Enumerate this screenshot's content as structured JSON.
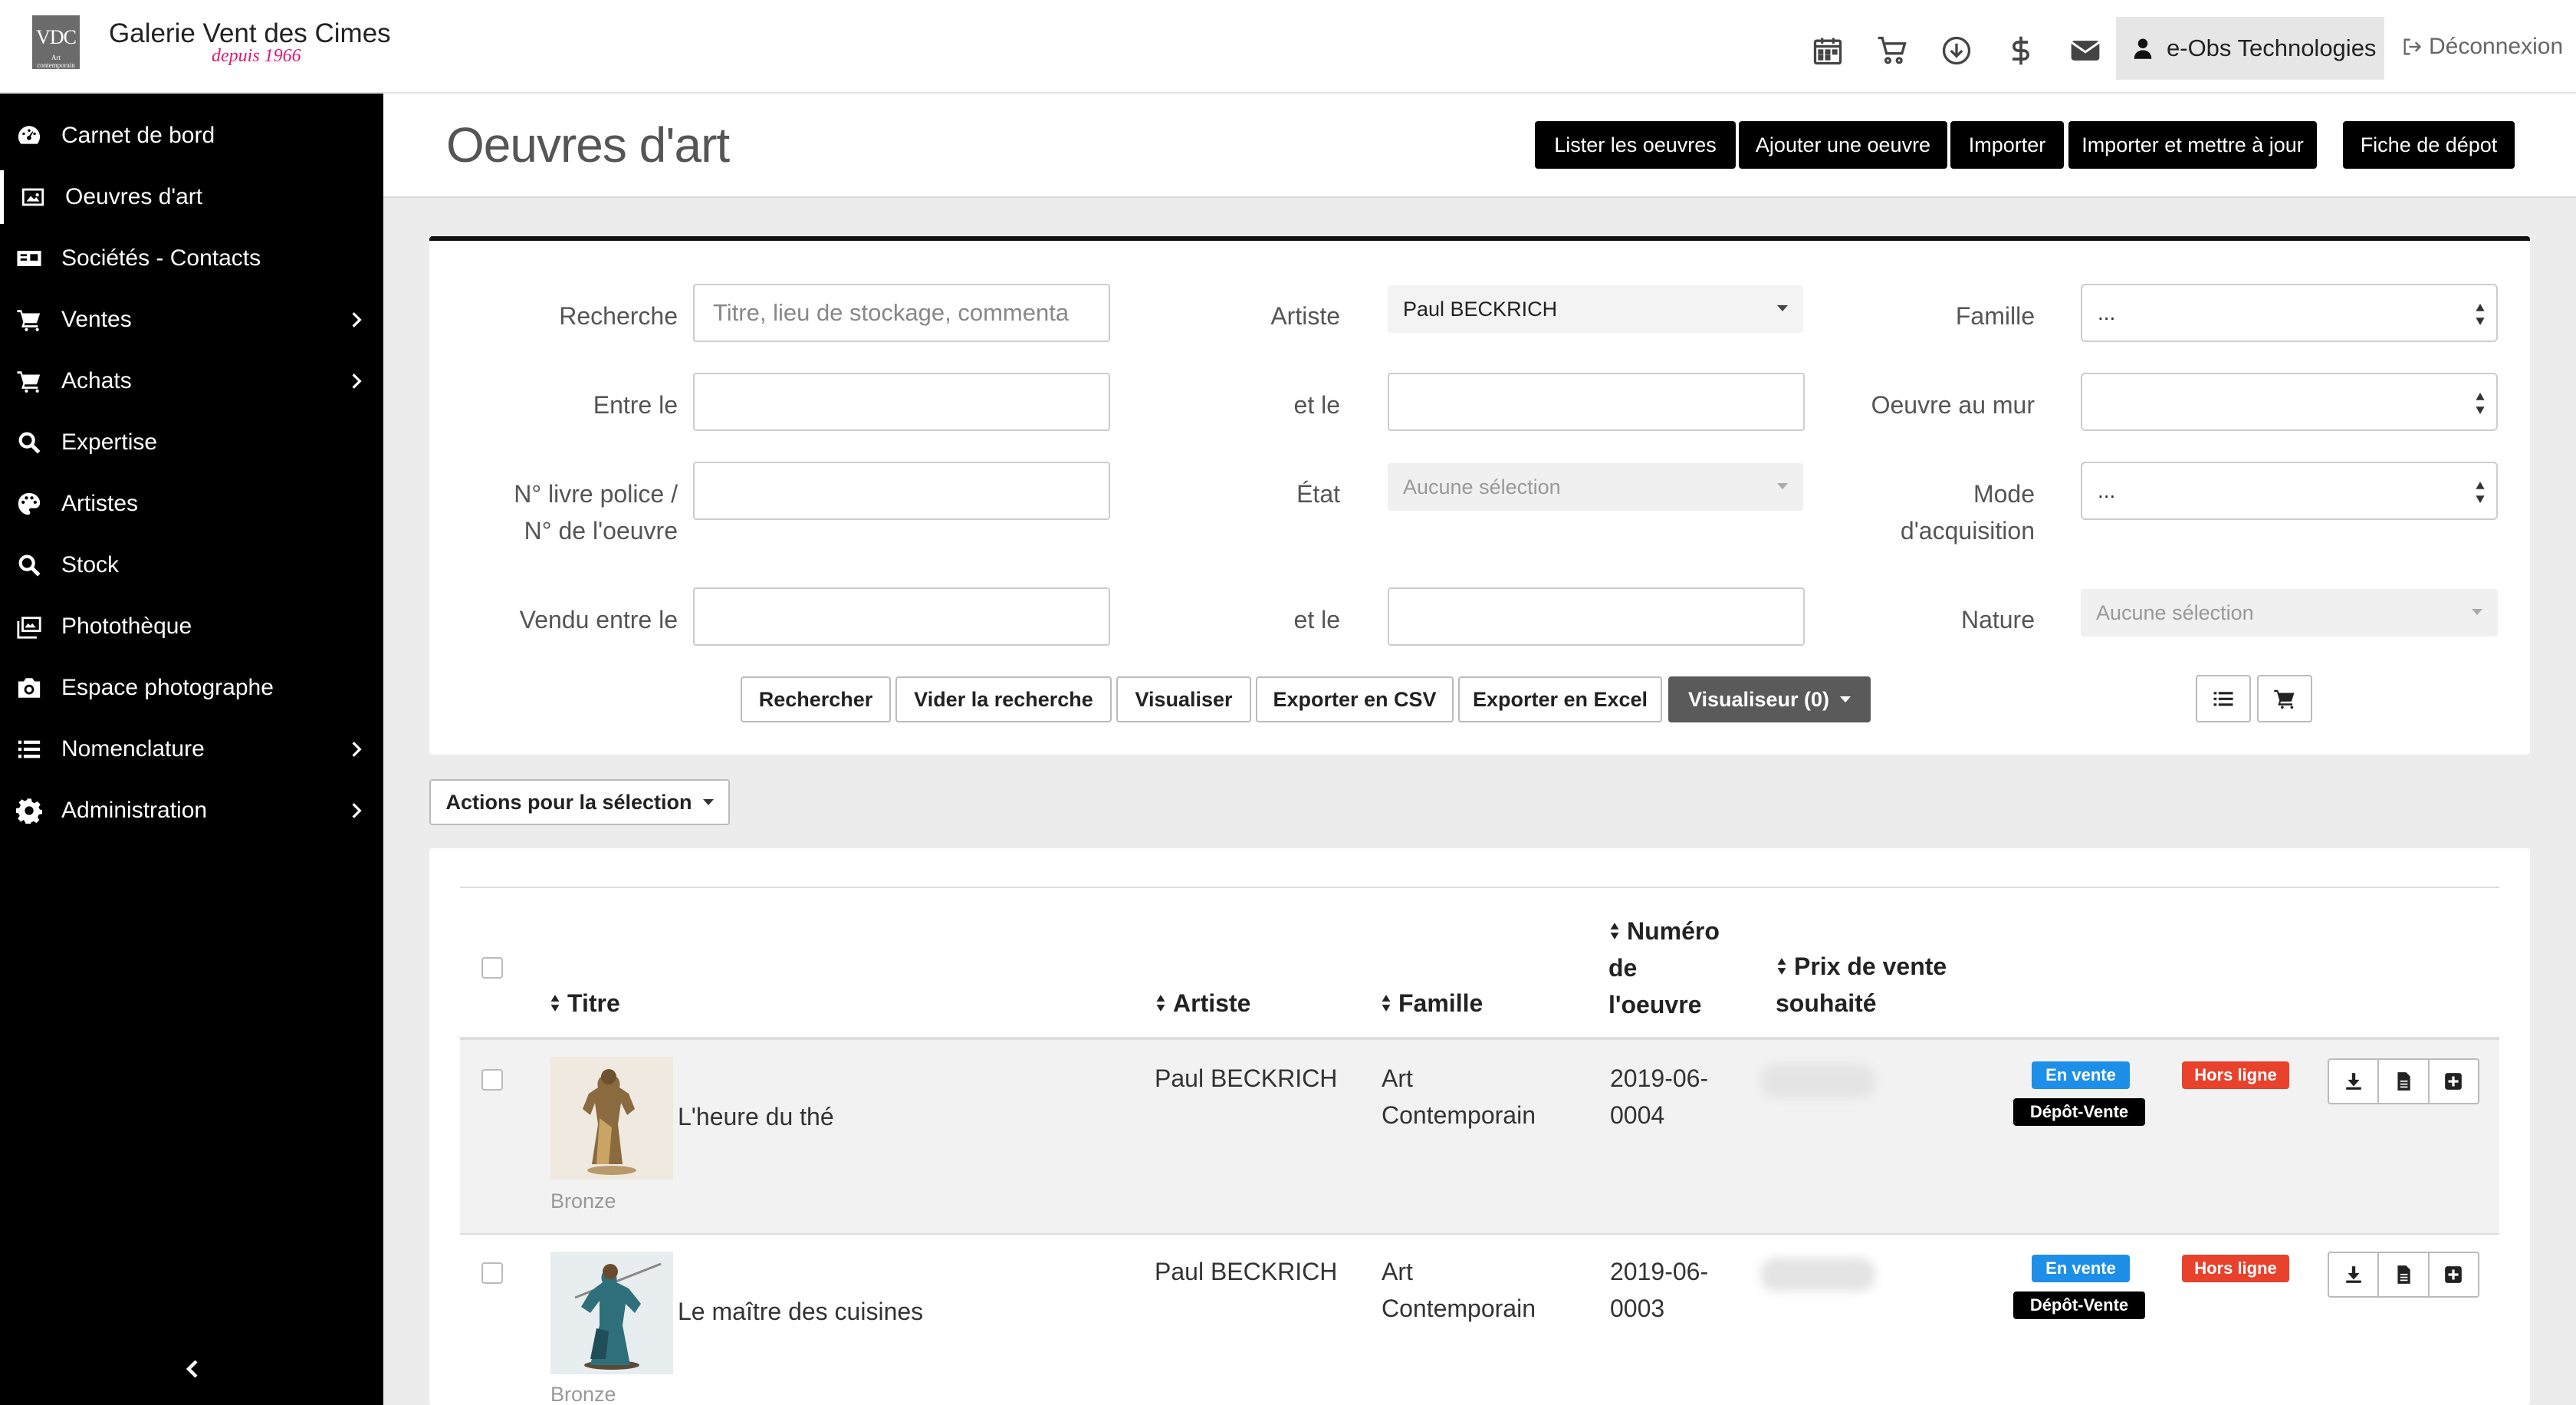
{
  "app": {
    "logo_text": "VDC",
    "logo_sub": "Art contemporain",
    "title": "Galerie Vent des Cimes",
    "tagline": "depuis 1966"
  },
  "topbar": {
    "icons": [
      "calendar-icon",
      "cart-icon",
      "download-icon",
      "dollar-icon",
      "mail-icon"
    ],
    "user_label": "e-Obs Technologies",
    "logout_label": "Déconnexion"
  },
  "sidebar": {
    "items": [
      {
        "label": "Carnet de bord",
        "icon": "dashboard-icon",
        "has_children": false,
        "active": false
      },
      {
        "label": "Oeuvres d'art",
        "icon": "image-icon",
        "has_children": false,
        "active": true
      },
      {
        "label": "Sociétés - Contacts",
        "icon": "contact-card-icon",
        "has_children": false,
        "active": false
      },
      {
        "label": "Ventes",
        "icon": "cart-icon",
        "has_children": true,
        "active": false
      },
      {
        "label": "Achats",
        "icon": "cart-icon",
        "has_children": true,
        "active": false
      },
      {
        "label": "Expertise",
        "icon": "search-icon",
        "has_children": false,
        "active": false
      },
      {
        "label": "Artistes",
        "icon": "palette-icon",
        "has_children": false,
        "active": false
      },
      {
        "label": "Stock",
        "icon": "search-icon",
        "has_children": false,
        "active": false
      },
      {
        "label": "Photothèque",
        "icon": "images-icon",
        "has_children": false,
        "active": false
      },
      {
        "label": "Espace photographe",
        "icon": "camera-icon",
        "has_children": false,
        "active": false
      },
      {
        "label": "Nomenclature",
        "icon": "list-icon",
        "has_children": true,
        "active": false
      },
      {
        "label": "Administration",
        "icon": "gear-icon",
        "has_children": true,
        "active": false
      }
    ]
  },
  "header": {
    "title": "Oeuvres d'art",
    "buttons": [
      "Lister les oeuvres",
      "Ajouter une oeuvre",
      "Importer",
      "Importer et mettre à jour",
      "Fiche de dépot"
    ]
  },
  "filters": {
    "recherche_label": "Recherche",
    "recherche_placeholder": "Titre, lieu de stockage, commenta",
    "artiste_label": "Artiste",
    "artiste_value": "Paul BECKRICH",
    "famille_label": "Famille",
    "famille_value": "...",
    "entre_label": "Entre le",
    "et_le_label": "et le",
    "mur_label": "Oeuvre au mur",
    "mur_value": "",
    "livre_label_1": "N° livre police /",
    "livre_label_2": "N° de l'oeuvre",
    "etat_label": "État",
    "etat_value": "Aucune sélection",
    "mode_label_1": "Mode",
    "mode_label_2": "d'acquisition",
    "mode_value": "...",
    "vendu_label": "Vendu entre le",
    "et_le_label_2": "et le",
    "nature_label": "Nature",
    "nature_value": "Aucune sélection",
    "buttons": [
      "Rechercher",
      "Vider la recherche",
      "Visualiser",
      "Exporter en CSV",
      "Exporter en Excel"
    ],
    "viewer_button": "Visualiseur (0)"
  },
  "actions_label": "Actions pour la sélection",
  "table": {
    "headers": {
      "titre": "Titre",
      "artiste": "Artiste",
      "famille": "Famille",
      "numero_1": "Numéro",
      "numero_2": "de",
      "numero_3": "l'oeuvre",
      "prix_1": "Prix de vente",
      "prix_2": "souhaité"
    },
    "rows": [
      {
        "title": "L'heure du thé",
        "material": "Bronze",
        "artist": "Paul BECKRICH",
        "famille_1": "Art",
        "famille_2": "Contemporain",
        "numero_1": "2019-06-",
        "numero_2": "0004",
        "status_sale": "En vente",
        "status_type": "Dépôt-Vente",
        "status_online": "Hors ligne"
      },
      {
        "title": "Le maître des cuisines",
        "material": "Bronze",
        "artist": "Paul BECKRICH",
        "famille_1": "Art",
        "famille_2": "Contemporain",
        "numero_1": "2019-06-",
        "numero_2": "0003",
        "status_sale": "En vente",
        "status_type": "Dépôt-Vente",
        "status_online": "Hors ligne"
      }
    ]
  },
  "colors": {
    "sidebar_bg": "#000000",
    "badge_blue": "#1e8fe8",
    "badge_red": "#e8412c",
    "tagline": "#e2186e"
  }
}
